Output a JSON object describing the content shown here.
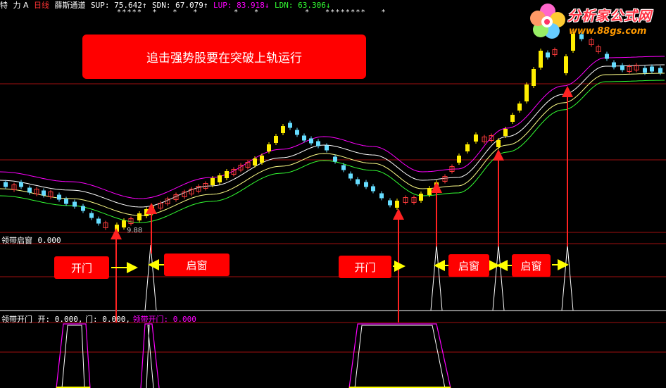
{
  "header": {
    "items": [
      {
        "text": "特",
        "color": "#ffffff"
      },
      {
        "text": "力",
        "color": "#ffffff"
      },
      {
        "text": "A",
        "color": "#ffffff"
      },
      {
        "text": "日线",
        "color": "#ff3333"
      },
      {
        "text": "薛斯通道",
        "color": "#ffffff"
      },
      {
        "text": "SUP: 75.642↑",
        "color": "#ffffff"
      },
      {
        "text": "SDN: 67.079↑",
        "color": "#ffffff"
      },
      {
        "text": "LUP: 83.918↓",
        "color": "#ff00ff"
      },
      {
        "text": "LDN: 63.306↓",
        "color": "#33ff33"
      }
    ],
    "star_marks": "*****  *   *   *       *   *         *   ********   *"
  },
  "banner": {
    "text": "追击强势股要在突破上轨运行"
  },
  "price_low_label": "9.88",
  "panel2": {
    "label": "领带启窗",
    "value": "0.000"
  },
  "panel3": {
    "label": "领带开门",
    "items": [
      {
        "text": "开: 0.000,",
        "color": "#ffffff"
      },
      {
        "text": "门: 0.000,",
        "color": "#ffffff"
      },
      {
        "text": "领带开门: 0.000",
        "color": "#ff00ff"
      }
    ]
  },
  "tags": [
    {
      "text": "开门"
    },
    {
      "text": "启窗"
    },
    {
      "text": "开门"
    },
    {
      "text": "启窗"
    },
    {
      "text": "启窗"
    }
  ],
  "logo": {
    "title": "分析家公式网",
    "url": "www.88gs.com"
  },
  "colors": {
    "up_candle": "#ff3b3b",
    "down_candle": "#66ddff",
    "signal_candle": "#ffee00",
    "upper_band": "#ff00ff",
    "mid_band": "#ffffff",
    "lower_band": "#ffff88",
    "low_band": "#33ff33",
    "arrow": "#ff2222",
    "separator": "#a01010"
  }
}
